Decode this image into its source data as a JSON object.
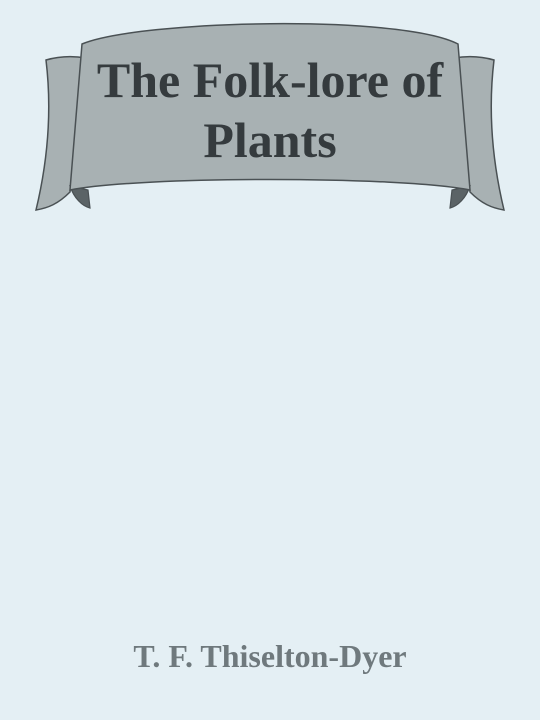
{
  "cover": {
    "title": "The Folk-lore of\nPlants",
    "author": "T. F. Thiselton-Dyer"
  },
  "colors": {
    "background": "#e4eff4",
    "banner_fill": "#a8b1b3",
    "banner_shadow": "#5b6366",
    "banner_stroke": "#4a5154",
    "title_text": "#353b3e",
    "author_text": "#6f797d"
  }
}
